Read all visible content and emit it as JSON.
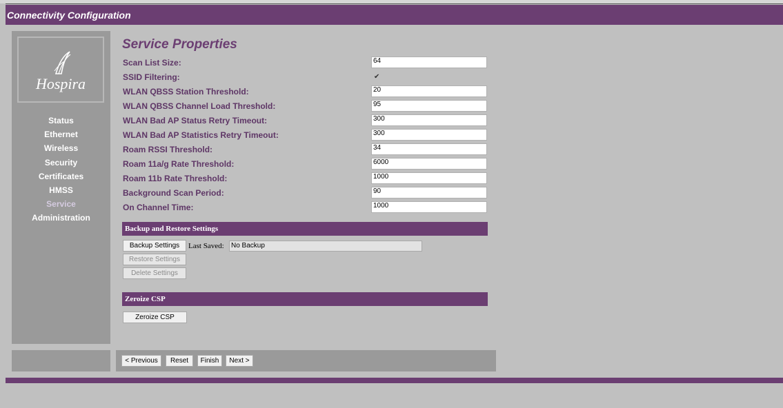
{
  "window": {
    "title": "Connectivity Configuration"
  },
  "sidebar": {
    "logo_text": "Hospira",
    "items": [
      {
        "label": "Status"
      },
      {
        "label": "Ethernet"
      },
      {
        "label": "Wireless"
      },
      {
        "label": "Security"
      },
      {
        "label": "Certificates"
      },
      {
        "label": "HMSS"
      },
      {
        "label": "Service",
        "active": true
      },
      {
        "label": "Administration"
      }
    ]
  },
  "main": {
    "title": "Service Properties",
    "fields": [
      {
        "label": "Scan List Size:",
        "value": "64"
      },
      {
        "label": "SSID Filtering:",
        "value": "✔",
        "type": "checkbox"
      },
      {
        "label": "WLAN QBSS Station Threshold:",
        "value": "20"
      },
      {
        "label": "WLAN QBSS Channel Load Threshold:",
        "value": "95"
      },
      {
        "label": "WLAN Bad AP Status Retry Timeout:",
        "value": "300"
      },
      {
        "label": "WLAN Bad AP Statistics Retry Timeout:",
        "value": "300"
      },
      {
        "label": "Roam RSSI Threshold:",
        "value": "34"
      },
      {
        "label": "Roam 11a/g Rate Threshold:",
        "value": "6000"
      },
      {
        "label": "Roam 11b Rate Threshold:",
        "value": "1000"
      },
      {
        "label": "Background Scan Period:",
        "value": "90"
      },
      {
        "label": "On Channel Time:",
        "value": "1000"
      }
    ]
  },
  "backup": {
    "header": "Backup and Restore Settings",
    "backup_label": "Backup Settings",
    "last_saved_label": "Last Saved:",
    "last_saved_value": "No Backup",
    "restore_label": "Restore Settings",
    "delete_label": "Delete Settings"
  },
  "zeroize": {
    "header": "Zeroize CSP",
    "button_label": "Zeroize CSP"
  },
  "footer": {
    "previous_label": "< Previous",
    "reset_label": "Reset",
    "finish_label": "Finish",
    "next_label": "Next >"
  },
  "colors": {
    "accent": "#6b3e72",
    "label_text": "#5e3666",
    "panel_gray": "#9a9a9a",
    "background": "#c0c0c0"
  }
}
